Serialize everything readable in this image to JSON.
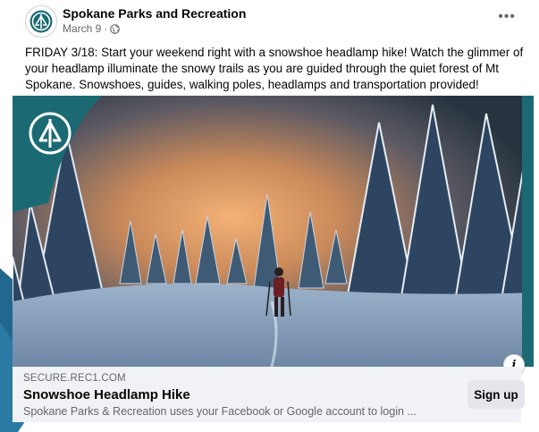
{
  "post": {
    "page_name": "Spokane Parks and Recreation",
    "date": "March 9",
    "audience_icon": "globe-icon",
    "more_icon": "more-options-icon",
    "more_label": "•••",
    "text": "FRIDAY 3/18: Start your weekend right with a snowshoe headlamp hike! Watch the glimmer of your headlamp illuminate the snowy trails as you are guided through the quiet forest of Mt Spokane. Snowshoes, guides, walking poles, headlamps and transportation provided!"
  },
  "link": {
    "domain": "SECURE.REC1.COM",
    "title": "Snowshoe Headlamp Hike",
    "description": "Spokane Parks & Recreation uses your Facebook or Google account to login ...",
    "cta_label": "Sign up",
    "info_icon": "info-icon",
    "info_label": "i"
  },
  "colors": {
    "accent": "#1b6a73",
    "background_shape": "#2c7ea6",
    "card_bg": "#f0f2f5",
    "secondary_text": "#65676b"
  }
}
